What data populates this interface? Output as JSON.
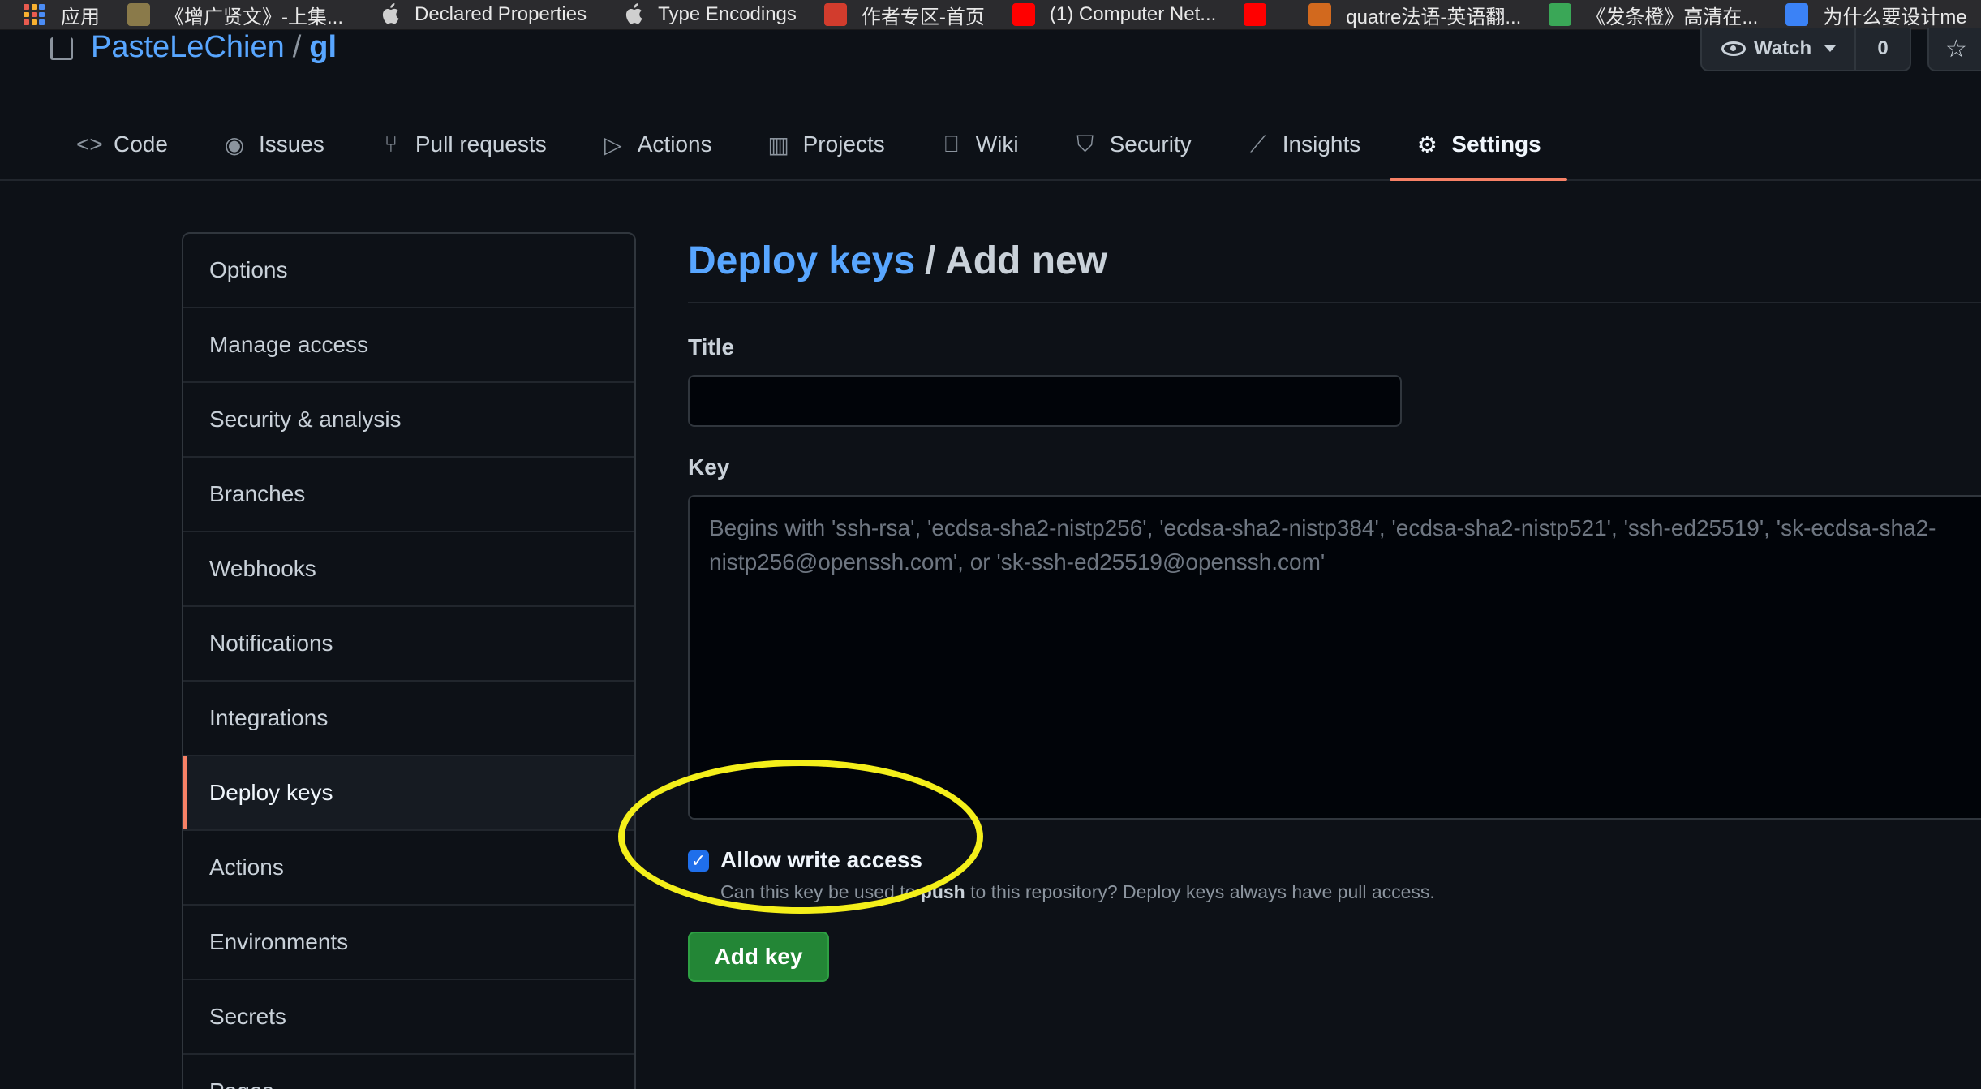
{
  "bookmarks": [
    {
      "label": "应用",
      "icon": "apps-grid-icon"
    },
    {
      "label": "《增广贤文》-上集...",
      "icon": "book-favicon",
      "color": "#8a7a4a"
    },
    {
      "label": "Declared Properties",
      "icon": "apple-icon"
    },
    {
      "label": "Type Encodings",
      "icon": "apple-icon"
    },
    {
      "label": "作者专区-首页",
      "icon": "site-favicon",
      "color": "#d23c2d"
    },
    {
      "label": "(1) Computer Net...",
      "icon": "youtube-icon",
      "color": "#ff0000"
    },
    {
      "label": "",
      "icon": "youtube-icon",
      "color": "#ff0000"
    },
    {
      "label": "quatre法语-英语翻...",
      "icon": "crest-favicon",
      "color": "#d2691e"
    },
    {
      "label": "《发条橙》高清在...",
      "icon": "leaf-favicon",
      "color": "#3aa757"
    },
    {
      "label": "为什么要设计me",
      "icon": "chevrons-favicon",
      "color": "#3b82f6"
    }
  ],
  "repo": {
    "owner": "PasteLeChien",
    "separator": "/",
    "name": "gl",
    "watch_label": "Watch",
    "watch_count": "0",
    "star_glyph": "☆"
  },
  "tabs": [
    {
      "label": "Code",
      "icon": "<>",
      "active": false
    },
    {
      "label": "Issues",
      "icon": "◉",
      "active": false
    },
    {
      "label": "Pull requests",
      "icon": "⑂",
      "active": false
    },
    {
      "label": "Actions",
      "icon": "▷",
      "active": false
    },
    {
      "label": "Projects",
      "icon": "▥",
      "active": false
    },
    {
      "label": "Wiki",
      "icon": "⎕",
      "active": false
    },
    {
      "label": "Security",
      "icon": "⛉",
      "active": false
    },
    {
      "label": "Insights",
      "icon": "⟋",
      "active": false
    },
    {
      "label": "Settings",
      "icon": "⚙",
      "active": true
    }
  ],
  "sidebar": {
    "items": [
      {
        "label": "Options",
        "active": false
      },
      {
        "label": "Manage access",
        "active": false
      },
      {
        "label": "Security & analysis",
        "active": false
      },
      {
        "label": "Branches",
        "active": false
      },
      {
        "label": "Webhooks",
        "active": false
      },
      {
        "label": "Notifications",
        "active": false
      },
      {
        "label": "Integrations",
        "active": false
      },
      {
        "label": "Deploy keys",
        "active": true
      },
      {
        "label": "Actions",
        "active": false
      },
      {
        "label": "Environments",
        "active": false
      },
      {
        "label": "Secrets",
        "active": false
      },
      {
        "label": "Pages",
        "active": false
      }
    ]
  },
  "main": {
    "crumb": "Deploy keys",
    "heading_rest": "/ Add new",
    "title_label": "Title",
    "title_value": "",
    "key_label": "Key",
    "key_placeholder": "Begins with 'ssh-rsa', 'ecdsa-sha2-nistp256', 'ecdsa-sha2-nistp384', 'ecdsa-sha2-nistp521', 'ssh-ed25519', 'sk-ecdsa-sha2-nistp256@openssh.com', or 'sk-ssh-ed25519@openssh.com'",
    "write_access_checked": true,
    "write_access_label": "Allow write access",
    "write_note_before": "Can this key be used to ",
    "write_note_bold": "push",
    "write_note_after": " to this repository? Deploy keys always have pull access.",
    "add_key_label": "Add key"
  },
  "colors": {
    "accent_link": "#58a6ff",
    "active_tab_underline": "#f78166",
    "primary_button": "#238636",
    "annotation": "#f4ef1a"
  }
}
